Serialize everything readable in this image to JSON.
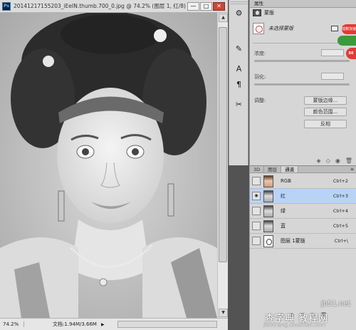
{
  "document": {
    "app_logo": "Ps",
    "title": "20141217155203_iEeIN.thumb.700_0.jpg @ 74.2% (图层 1, 红/8) *",
    "window_buttons": [
      "—",
      "□",
      "✕"
    ],
    "zoom": "74.2%",
    "doc_info": "文档:1.94M/3.66M",
    "status_arrow": "▶"
  },
  "toolbar": {
    "icons": [
      "adjust-icon",
      "paint-icon",
      "type-icon",
      "pilcrow-icon",
      "tools-icon"
    ],
    "glyphs": [
      "⚙",
      "✎",
      "A",
      "¶",
      "✂"
    ]
  },
  "properties": {
    "tab": "属性",
    "header": "蒙版",
    "selection_label": "未选择蒙版",
    "density_label": "浓度:",
    "feather_label": "羽化:",
    "adjust_label": "调整:",
    "buttons": [
      "蒙版边缘...",
      "颜色范围...",
      "反相"
    ],
    "footer_glyphs": [
      "◈",
      "◇",
      "◉",
      "🗑"
    ]
  },
  "badge": {
    "top_text": "成教加速",
    "bottom_text": "88"
  },
  "layers": {
    "tabs": [
      "3D",
      "图层",
      "通道"
    ],
    "active_tab": 2,
    "menu_glyph": "≡",
    "channels": [
      {
        "name": "RGB",
        "shortcut": "Ctrl+2",
        "visible": false,
        "selected": false
      },
      {
        "name": "红",
        "shortcut": "Ctrl+3",
        "visible": true,
        "selected": true
      },
      {
        "name": "绿",
        "shortcut": "Ctrl+4",
        "visible": false,
        "selected": false
      },
      {
        "name": "蓝",
        "shortcut": "Ctrl+5",
        "visible": false,
        "selected": false
      },
      {
        "name": "图层 1蒙版",
        "shortcut": "Ctrl+\\",
        "visible": false,
        "selected": false
      }
    ],
    "eye_glyph": "◉",
    "footer_glyphs": [
      "◌",
      "◐",
      "▣",
      "▢",
      "🗑"
    ]
  },
  "watermark": {
    "line1": "jb51.net",
    "line2": "查字典 教程网",
    "line3": "jiaocheng.chazidian.com"
  }
}
